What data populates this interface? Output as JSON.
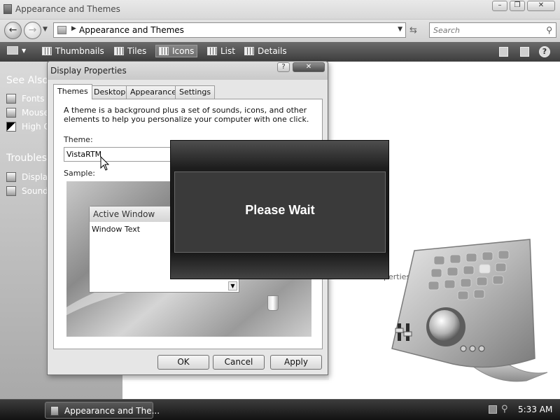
{
  "window": {
    "title": "Appearance and Themes",
    "controls": {
      "minimize": "–",
      "maximize": "❐",
      "close": "✕"
    }
  },
  "address": {
    "path": "Appearance and Themes",
    "search_placeholder": "Search"
  },
  "toolbar": {
    "thumbnails": "Thumbnails",
    "tiles": "Tiles",
    "icons": "Icons",
    "list": "List",
    "details": "Details",
    "help": "?"
  },
  "sidebar": {
    "see_also": "See Also",
    "see_also_items": [
      "Fonts",
      "Mouse",
      "High C"
    ],
    "troubleshoot": "Troublesh",
    "troubleshoot_items": [
      "Display",
      "Sound"
    ]
  },
  "background_label": "perties",
  "dialog": {
    "title": "Display Properties",
    "help_btn": "?",
    "close_btn": "✕",
    "tabs": [
      "Themes",
      "Desktop",
      "Appearance",
      "Settings"
    ],
    "active_tab": "Themes",
    "description": "A theme is a background plus a set of sounds, icons, and other elements to help you personalize your computer with one click.",
    "theme_label": "Theme:",
    "theme_value": "VistaRTM",
    "sample_label": "Sample:",
    "sample_window_title": "Active Window",
    "sample_window_text": "Window Text",
    "buttons": {
      "ok": "OK",
      "cancel": "Cancel",
      "apply": "Apply"
    }
  },
  "overlay": {
    "message": "Please Wait"
  },
  "taskbar": {
    "button_label": "Appearance and The...",
    "clock": "5:33 AM"
  }
}
